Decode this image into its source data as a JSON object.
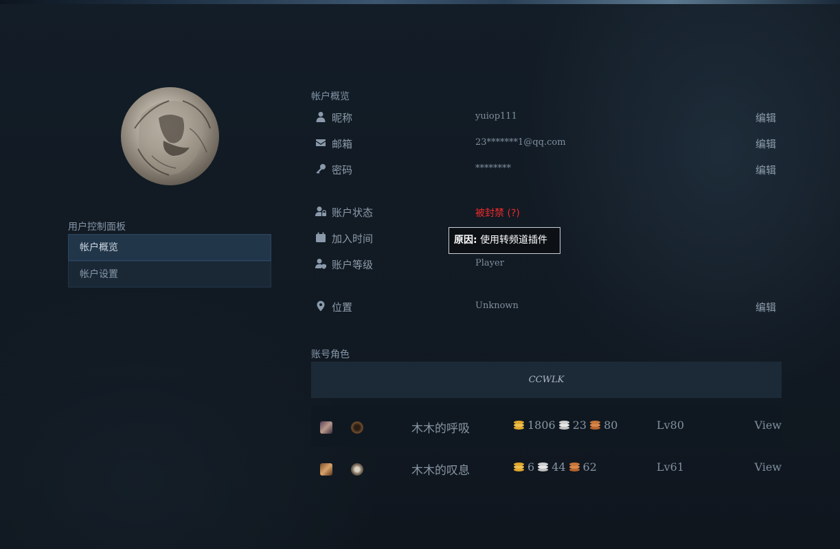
{
  "sidebar": {
    "panel_title": "用户控制面板",
    "items": [
      {
        "label": "帐户概览",
        "active": true
      },
      {
        "label": "帐户设置",
        "active": false
      }
    ]
  },
  "overview": {
    "title": "帐户概览",
    "rows": [
      {
        "icon": "user-icon",
        "label": "昵称",
        "value": "yuiop111",
        "edit": "编辑"
      },
      {
        "icon": "envelope-icon",
        "label": "邮箱",
        "value": "23*******1@qq.com",
        "edit": "编辑"
      },
      {
        "icon": "key-icon",
        "label": "密码",
        "value": "********",
        "edit": "编辑"
      },
      {
        "icon": "user-lock-icon",
        "label": "账户状态",
        "value": "被封禁 (?)",
        "value_color": "#ee2a2a"
      },
      {
        "icon": "calendar-icon",
        "label": "加入时间",
        "value": ""
      },
      {
        "icon": "user-shield-icon",
        "label": "账户等级",
        "value": "Player"
      },
      {
        "icon": "map-marker-icon",
        "label": "位置",
        "value": "Unknown",
        "edit": "编辑"
      }
    ]
  },
  "tooltip": {
    "label": "原因:",
    "text": "使用转频道插件"
  },
  "characters": {
    "title": "账号角色",
    "realm": "CCWLK",
    "list": [
      {
        "name": "木木的呼吸",
        "gold": "1806",
        "silver": "23",
        "copper": "80",
        "level": "Lv80",
        "view": "View",
        "race_icon": "undead-race-icon",
        "class_icon": "rogue-class-icon"
      },
      {
        "name": "木木的叹息",
        "gold": "6",
        "silver": "44",
        "copper": "62",
        "level": "Lv61",
        "view": "View",
        "race_icon": "tauren-race-icon",
        "class_icon": "warrior-class-icon"
      }
    ]
  },
  "colors": {
    "gold": "#e0a82e",
    "silver": "#d8d8d8",
    "copper": "#c8753a",
    "banned": "#ee2a2a"
  }
}
